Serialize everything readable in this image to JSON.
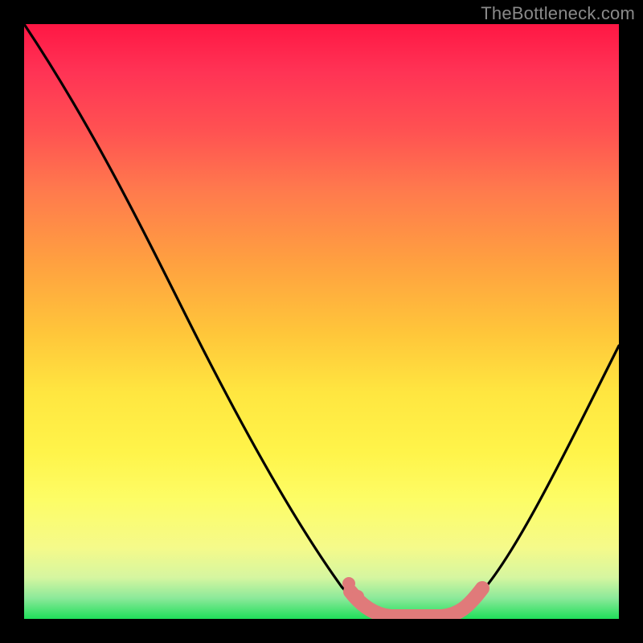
{
  "watermark": {
    "text": "TheBottleneck.com"
  },
  "chart_data": {
    "type": "line",
    "title": "",
    "xlabel": "",
    "ylabel": "",
    "xlim": [
      0,
      100
    ],
    "ylim": [
      0,
      100
    ],
    "grid": false,
    "series": [
      {
        "name": "bottleneck-curve",
        "x": [
          0,
          8,
          16,
          24,
          32,
          40,
          48,
          52,
          56,
          60,
          64,
          68,
          72,
          78,
          84,
          90,
          96,
          100
        ],
        "values": [
          100,
          88,
          74,
          60,
          46,
          32,
          18,
          12,
          6,
          2,
          0,
          0,
          1,
          6,
          14,
          24,
          36,
          46
        ]
      },
      {
        "name": "sweet-spot-highlight",
        "x": [
          56,
          58,
          60,
          62,
          64,
          66,
          68,
          70,
          72,
          74,
          76,
          78
        ],
        "values": [
          3.0,
          1.6,
          0.8,
          0.4,
          0.2,
          0.2,
          0.2,
          0.4,
          0.8,
          1.6,
          3.0,
          5.0
        ]
      }
    ],
    "background_gradient": {
      "top": "#ff1744",
      "mid": "#ffe640",
      "bottom": "#1fdf5a"
    }
  }
}
